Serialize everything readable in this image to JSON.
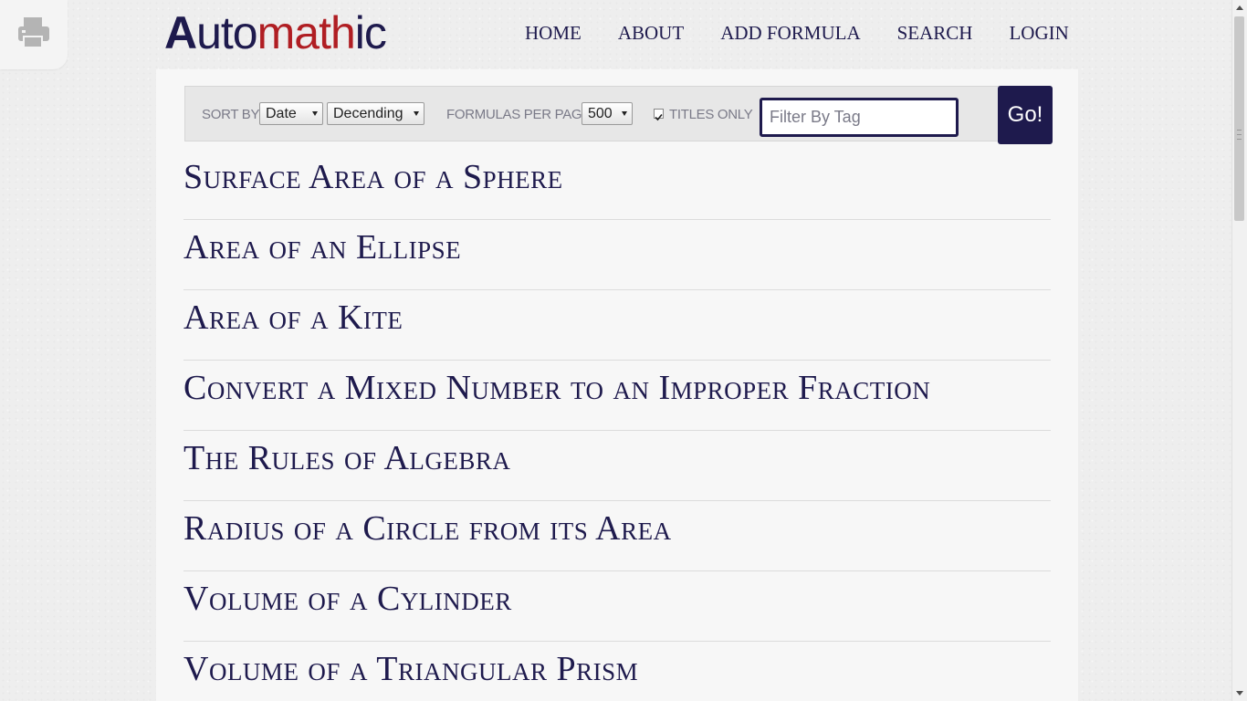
{
  "print_icon": "printer-icon",
  "logo": {
    "part_a": "A",
    "part_uto": "uto",
    "part_math": "math",
    "part_ic": "ic"
  },
  "nav": {
    "items": [
      "HOME",
      "ABOUT",
      "ADD FORMULA",
      "SEARCH",
      "LOGIN"
    ]
  },
  "toolbar": {
    "sort_by_label": "SORT BY:",
    "sort_field_value": "Date",
    "sort_order_value": "Decending",
    "per_page_label": "FORMULAS PER PAGE:",
    "per_page_value": "500",
    "titles_only_label": "TITLES ONLY",
    "titles_only_checked": true,
    "filter_placeholder": "Filter By Tag",
    "go_label": "Go!"
  },
  "formulas": [
    "Surface Area of a Sphere",
    "Area of an Ellipse",
    "Area of a Kite",
    "Convert a Mixed Number to an Improper Fraction",
    "The Rules of Algebra",
    "Radius of a Circle from its Area",
    "Volume of a Cylinder",
    "Volume of a Triangular Prism"
  ],
  "colors": {
    "brand_navy": "#1e1a4d",
    "brand_red": "#b01e23"
  }
}
